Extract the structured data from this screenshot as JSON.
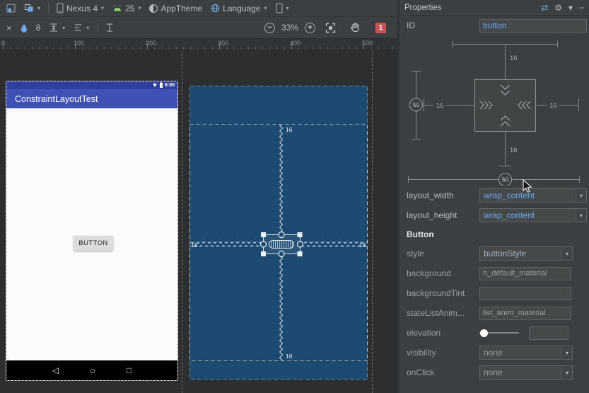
{
  "colors": {
    "accent_blue": "#6fa8f5",
    "blueprint_bg": "#1d4a70",
    "actionbar_blue": "#3f51b5",
    "statusbar_blue": "#303f9f",
    "error_red": "#c75450"
  },
  "icons": {
    "caret": "▾",
    "close": "×",
    "swap": "⇄",
    "gear": "⚙",
    "collapse": "−",
    "zoom_out": "−",
    "zoom_in": "+",
    "back": "◁",
    "home": "○",
    "recents": "□"
  },
  "toolbar": {
    "device": "Nexus 4",
    "api_level": "25",
    "theme": "AppTheme",
    "language": "Language"
  },
  "design_toolbar": {
    "default_margin": "8",
    "zoom_level": "33%",
    "error_count": "1"
  },
  "ruler": {
    "labels": [
      "0",
      "100",
      "200",
      "300",
      "400",
      "500"
    ]
  },
  "designer": {
    "status_time": "6:00",
    "actionbar_title": "ConstraintLayoutTest",
    "button_label": "BUTTON",
    "blueprint_margins": {
      "top": "16",
      "left": "16",
      "right": "16",
      "bottom": "16"
    }
  },
  "properties": {
    "title": "Properties",
    "id": {
      "label": "ID",
      "value": "button"
    },
    "inspector": {
      "margin_top": "16",
      "margin_left": "16",
      "margin_right": "16",
      "margin_bottom": "16",
      "vertical_bias": "50",
      "horizontal_bias": "50"
    },
    "layout_width": {
      "label": "layout_width",
      "value": "wrap_content"
    },
    "layout_height": {
      "label": "layout_height",
      "value": "wrap_content"
    },
    "section_title": "Button",
    "style": {
      "label": "style",
      "value": "buttonStyle"
    },
    "background": {
      "label": "background",
      "value": "n_default_material"
    },
    "background_tint": {
      "label": "backgroundTint",
      "value": ""
    },
    "state_list_anim": {
      "label": "stateListAnim...",
      "value": "list_anim_material"
    },
    "elevation": {
      "label": "elevation",
      "value": ""
    },
    "visibility": {
      "label": "visibility",
      "value": "none"
    },
    "on_click": {
      "label": "onClick",
      "value": "none"
    }
  }
}
